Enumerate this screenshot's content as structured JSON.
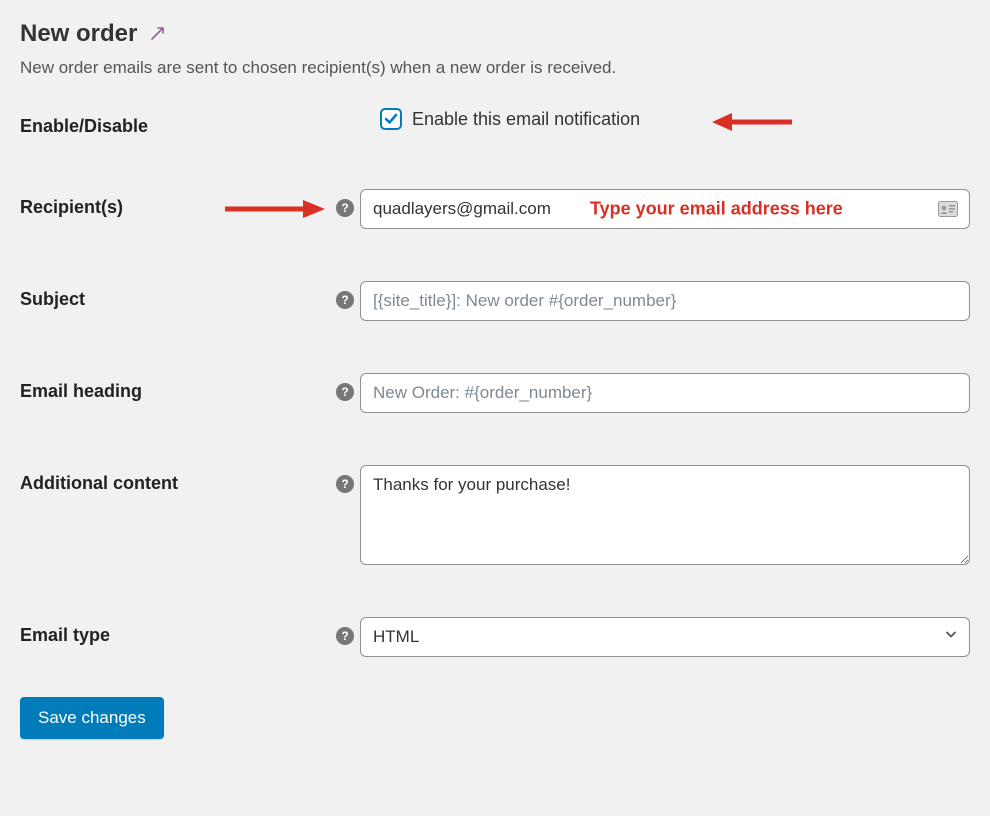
{
  "page_title": "New order",
  "description": "New order emails are sent to chosen recipient(s) when a new order is received.",
  "rows": {
    "enable": {
      "label": "Enable/Disable",
      "checkbox_label": "Enable this email notification",
      "checked": true
    },
    "recipients": {
      "label": "Recipient(s)",
      "value": "quadlayers@gmail.com",
      "annotation": "Type your email address here"
    },
    "subject": {
      "label": "Subject",
      "placeholder": "[{site_title}]: New order #{order_number}",
      "value": ""
    },
    "heading": {
      "label": "Email heading",
      "placeholder": "New Order: #{order_number}",
      "value": ""
    },
    "additional": {
      "label": "Additional content",
      "value": "Thanks for your purchase!"
    },
    "email_type": {
      "label": "Email type",
      "selected": "HTML"
    }
  },
  "save_button": "Save changes",
  "colors": {
    "accent": "#007cba",
    "annotation": "#d93025"
  }
}
